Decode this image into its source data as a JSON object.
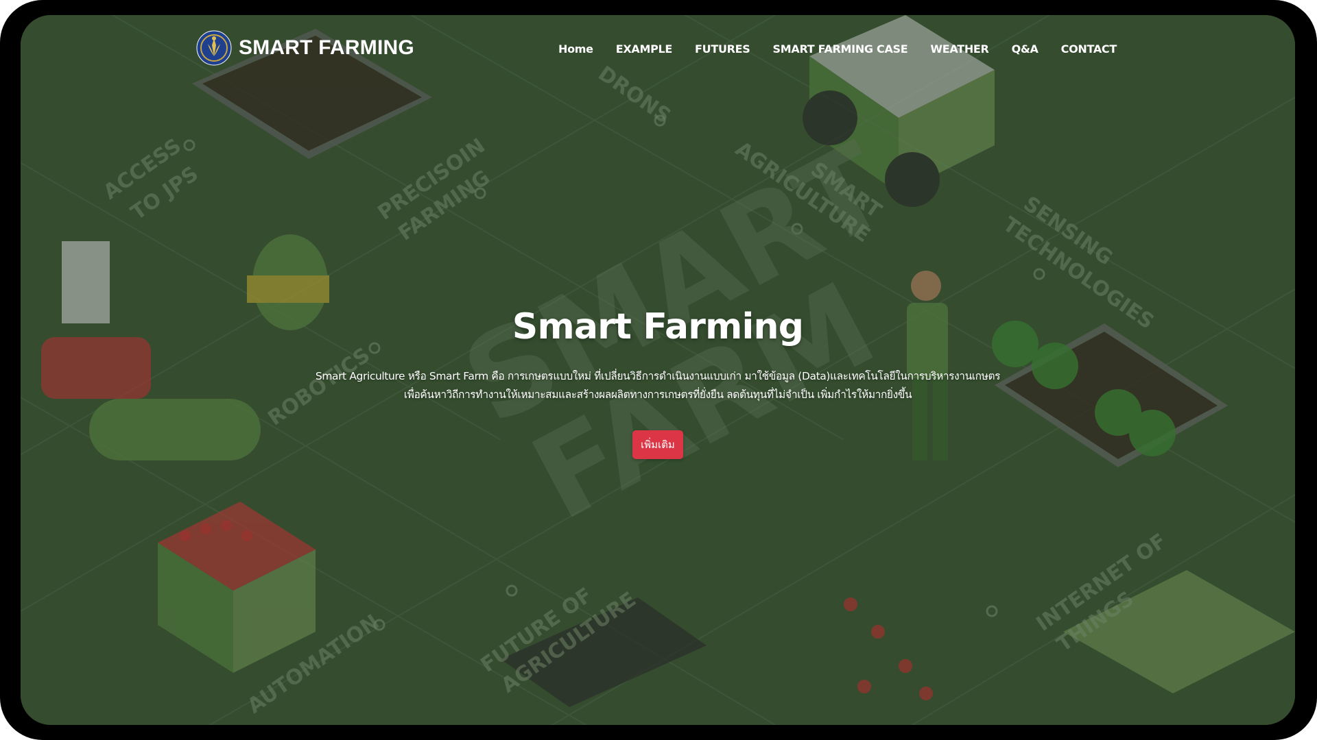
{
  "brand": {
    "name": "SMART FARMING",
    "logo_icon": "institution-seal-icon"
  },
  "nav": {
    "items": [
      {
        "label": "Home"
      },
      {
        "label": "EXAMPLE"
      },
      {
        "label": "FUTURES"
      },
      {
        "label": "SMART FARMING CASE"
      },
      {
        "label": "WEATHER"
      },
      {
        "label": "Q&A"
      },
      {
        "label": "CONTACT"
      }
    ]
  },
  "hero": {
    "title": "Smart Farming",
    "description_line1": "Smart Agriculture หรือ Smart Farm คือ การเกษตรแบบใหม่ ที่เปลี่ยนวิธีการดำเนินงานแบบเก่า มาใช้ข้อมูล (Data)และเทคโนโลยีในการบริหารงานเกษตร",
    "description_line2": "เพื่อค้นหาวิถีการทำงานให้เหมาะสมและสร้างผลผลิตทางการเกษตรที่ยั่งยืน ลดต้นทุนที่ไม่จำเป็น เพิ่มกำไรให้มากยิ่งขึ้น",
    "button_label": "เพิ่มเติม"
  },
  "background": {
    "labels": [
      "ACCESS TO JPS",
      "PRECISOIN FARMING",
      "DRONS",
      "SMART AGRICULTURE",
      "SENSING TECHNOLOGIES",
      "ROBOTICS",
      "SMART FARM",
      "AUTOMATION",
      "FUTURE OF AGRICULTURE",
      "INTERNET OF THINGS"
    ]
  },
  "colors": {
    "background": "#3b5534",
    "accent_button": "#dc3545",
    "text": "#ffffff"
  }
}
